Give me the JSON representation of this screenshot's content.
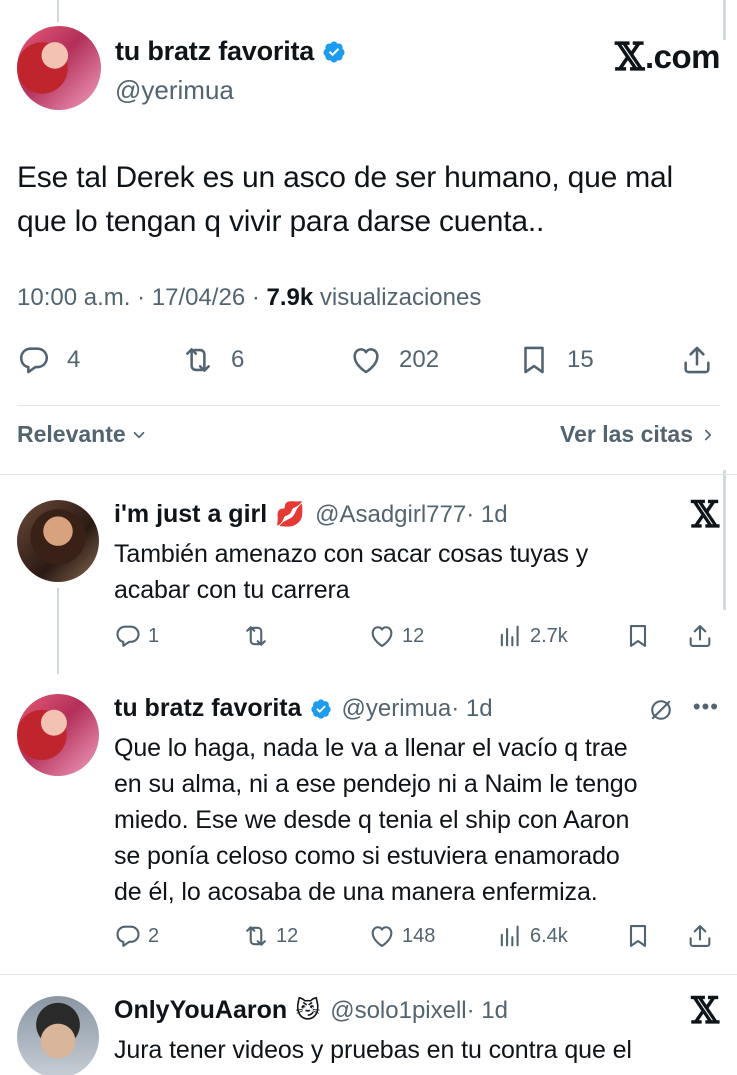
{
  "main_tweet": {
    "display_name": "tu bratz favorita",
    "handle": "@yerimua",
    "brand": ".com",
    "text_line1": "Ese tal Derek es un asco de ser humano, que mal",
    "text_line2": "que lo tengan q vivir para darse cuenta..",
    "time": "10:00 a.m.",
    "sep": "·",
    "date": "17/04/26",
    "views_count": "7.9k",
    "views_label": "visualizaciones",
    "replies": "4",
    "retweets": "6",
    "likes": "202",
    "bookmarks": "15"
  },
  "sort": {
    "left_label": "Relevante",
    "right_label": "Ver las citas"
  },
  "replies": [
    {
      "display_name": "i'm just a girl",
      "emoji": "💋",
      "handle": "@Asadgirl777",
      "age": "· 1d",
      "line1": "También amenazo con sacar cosas tuyas y",
      "line2": "acabar con tu carrera",
      "replies": "1",
      "retweets": "",
      "likes": "12",
      "views": "2.7k"
    },
    {
      "display_name": "tu bratz favorita",
      "handle": "@yerimua",
      "age": "· 1d",
      "line1": "Que lo haga, nada le va a llenar el vacío q trae",
      "line2": "en su alma, ni a ese pendejo ni a Naim le tengo",
      "line3": "miedo. Ese we desde q tenia el ship con Aaron",
      "line4": "se ponía celoso como si estuviera enamorado",
      "line5": "de él, lo acosaba de una manera enfermiza.",
      "replies": "2",
      "retweets": "12",
      "likes": "148",
      "views": "6.4k"
    },
    {
      "display_name": "OnlyYouAaron",
      "emoji": "😼",
      "handle": "@solo1pixell",
      "age": "· 1d",
      "line1": "Jura tener videos y pruebas en tu contra que el"
    }
  ],
  "colors": {
    "text": "#0f1419",
    "muted": "#536471",
    "verified": "#1d9bf0",
    "divider": "#e1e8ed"
  }
}
